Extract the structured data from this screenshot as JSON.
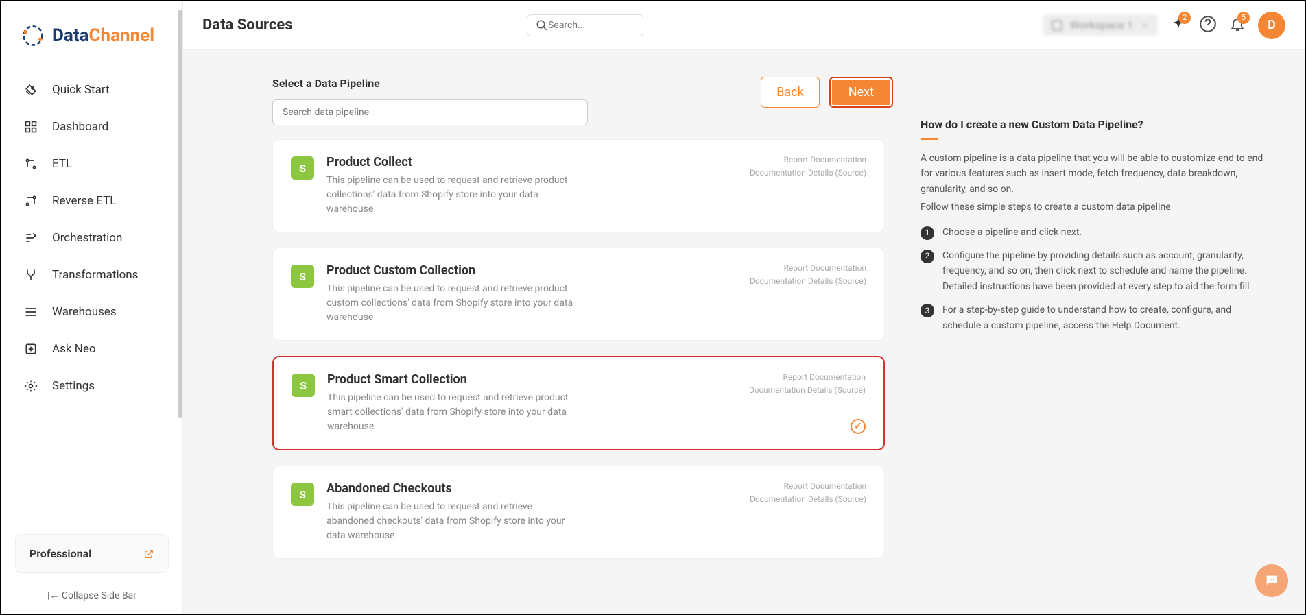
{
  "header": {
    "page_title": "Data Sources",
    "search_placeholder": "Search...",
    "workspace_label": "Workspace 1",
    "sparkle_badge": "2",
    "bell_badge": "5",
    "avatar_letter": "D"
  },
  "sidebar": {
    "logo_text1": "Data",
    "logo_text2": "Channel",
    "items": [
      {
        "label": "Quick Start",
        "icon": "rocket-icon"
      },
      {
        "label": "Dashboard",
        "icon": "dashboard-icon"
      },
      {
        "label": "ETL",
        "icon": "etl-icon"
      },
      {
        "label": "Reverse ETL",
        "icon": "reverse-etl-icon"
      },
      {
        "label": "Orchestration",
        "icon": "orchestration-icon"
      },
      {
        "label": "Transformations",
        "icon": "transformations-icon"
      },
      {
        "label": "Warehouses",
        "icon": "warehouses-icon"
      },
      {
        "label": "Ask Neo",
        "icon": "ask-neo-icon"
      },
      {
        "label": "Settings",
        "icon": "settings-icon"
      }
    ],
    "plan": "Professional",
    "collapse": "Collapse Side Bar"
  },
  "pipeline": {
    "section_title": "Select a Data Pipeline",
    "search_placeholder": "Search data pipeline",
    "back": "Back",
    "next": "Next",
    "link_docs": "Report Documentation",
    "link_details": "Documentation Details (Source)",
    "cards": [
      {
        "title": "Product Collect",
        "desc": "This pipeline can be used to request and retrieve product collections' data from Shopify store into your data warehouse",
        "selected": false
      },
      {
        "title": "Product Custom Collection",
        "desc": "This pipeline can be used to request and retrieve product custom collections' data from Shopify store into your data warehouse",
        "selected": false
      },
      {
        "title": "Product Smart Collection",
        "desc": "This pipeline can be used to request and retrieve product smart collections' data from Shopify store into your data warehouse",
        "selected": true
      },
      {
        "title": "Abandoned Checkouts",
        "desc": "This pipeline can be used to request and retrieve abandoned checkouts' data from Shopify store into your data warehouse",
        "selected": false
      }
    ]
  },
  "help": {
    "title": "How do I create a new Custom Data Pipeline?",
    "p1": "A custom pipeline is a data pipeline that you will be able to customize end to end for various features such as insert mode, fetch frequency, data breakdown, granularity, and so on.",
    "p2": "Follow these simple steps to create a custom data pipeline",
    "steps": [
      "Choose a pipeline and click next.",
      "Configure the pipeline by providing details such as account, granularity, frequency, and so on, then click next to schedule and name the pipeline. Detailed instructions have been provided at every step to aid the form fill",
      "For a step-by-step guide to understand how to create, configure, and schedule a custom pipeline, access the Help Document."
    ]
  }
}
